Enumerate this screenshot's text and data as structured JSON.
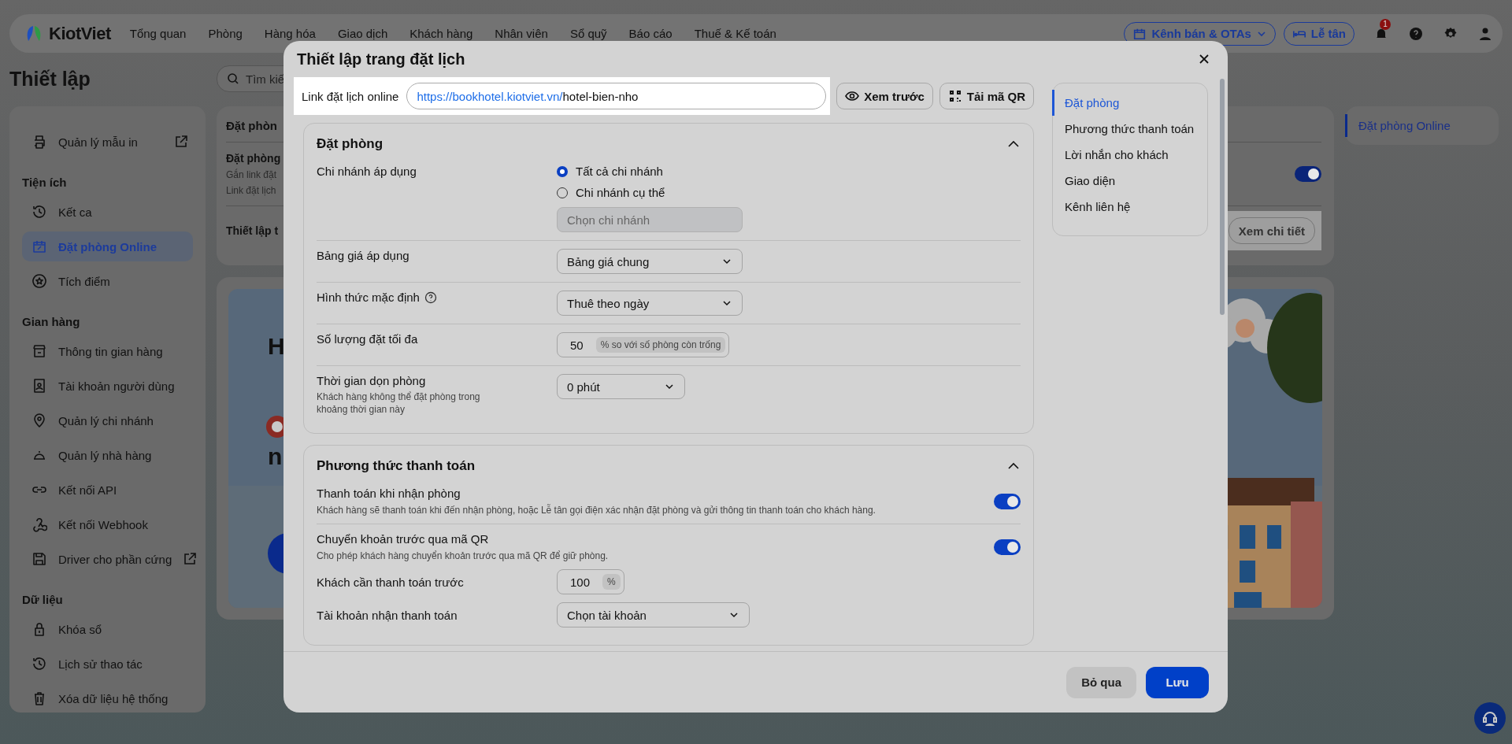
{
  "top_nav": {
    "logo": "KiotViet",
    "items": [
      "Tổng quan",
      "Phòng",
      "Hàng hóa",
      "Giao dịch",
      "Khách hàng",
      "Nhân viên",
      "Sổ quỹ",
      "Báo cáo",
      "Thuế & Kế toán"
    ],
    "channel_button": "Kênh bán & OTAs",
    "reception_button": "Lễ tân",
    "notification_count": "1"
  },
  "page": {
    "title": "Thiết lập",
    "search_placeholder": "Tìm kiế"
  },
  "sidebar": {
    "sections": [
      {
        "items": [
          {
            "label": "Quản lý mẫu in",
            "external": true,
            "selected": false
          }
        ]
      },
      {
        "heading": "Tiện ích",
        "items": [
          {
            "label": "Kết ca",
            "external": false,
            "selected": false
          },
          {
            "label": "Đặt phòng Online",
            "external": false,
            "selected": true
          },
          {
            "label": "Tích điểm",
            "external": false,
            "selected": false
          }
        ]
      },
      {
        "heading": "Gian hàng",
        "items": [
          {
            "label": "Thông tin gian hàng",
            "external": false,
            "selected": false
          },
          {
            "label": "Tài khoản người dùng",
            "external": false,
            "selected": false
          },
          {
            "label": "Quản lý chi nhánh",
            "external": false,
            "selected": false
          },
          {
            "label": "Quản lý nhà hàng",
            "external": false,
            "selected": false
          },
          {
            "label": "Kết nối API",
            "external": false,
            "selected": false
          },
          {
            "label": "Kết nối Webhook",
            "external": false,
            "selected": false
          },
          {
            "label": "Driver cho phần cứng",
            "external": true,
            "selected": false
          }
        ]
      },
      {
        "heading": "Dữ liệu",
        "items": [
          {
            "label": "Khóa sổ",
            "external": false,
            "selected": false
          },
          {
            "label": "Lịch sử thao tác",
            "external": false,
            "selected": false
          },
          {
            "label": "Xóa dữ liệu hệ thống",
            "external": false,
            "selected": false
          }
        ]
      }
    ]
  },
  "settings_card": {
    "title": "Đặt phòn",
    "feature_title": "Đặt phòng",
    "feature_lines": [
      "Gắn link đặt",
      "Link đặt lịch"
    ],
    "enabled": true,
    "setup_label": "Thiết lập t",
    "detail_button": "Xem chi tiết"
  },
  "banner": {
    "lines": [
      "H",
      "n"
    ]
  },
  "right_nav": {
    "items": [
      {
        "label": "Đặt phòng Online",
        "selected": true
      }
    ]
  },
  "modal": {
    "title": "Thiết lập trang đặt lịch",
    "link": {
      "label": "Link đặt lịch online",
      "base_url": "https://bookhotel.kiotviet.vn/",
      "slug": "hotel-bien-nho"
    },
    "preview_button": "Xem trước",
    "qr_button": "Tải mã QR",
    "sections": [
      {
        "title": "Đặt phòng",
        "expanded": true,
        "rows": [
          {
            "kind": "radio",
            "label": "Chi nhánh áp dụng",
            "options": [
              {
                "label": "Tất cả chi nhánh",
                "selected": true
              },
              {
                "label": "Chi nhánh cụ thể",
                "selected": false
              }
            ],
            "select": {
              "placeholder": "Chọn chi nhánh",
              "disabled": true
            }
          },
          {
            "kind": "select",
            "label": "Bảng giá áp dụng",
            "help": false,
            "value": "Bảng giá chung"
          },
          {
            "kind": "select",
            "label": "Hình thức mặc định",
            "help": true,
            "value": "Thuê theo ngày"
          },
          {
            "kind": "number",
            "label": "Số lượng đặt tối đa",
            "value": "50",
            "unit": "% so với số phòng còn trống"
          },
          {
            "kind": "duration",
            "label": "Thời gian dọn phòng",
            "hint": "Khách hàng không thể đặt phòng trong khoảng thời gian này",
            "value": "0 phút"
          }
        ]
      },
      {
        "title": "Phương thức thanh toán",
        "expanded": true,
        "rows": [
          {
            "kind": "toggle",
            "label": "Thanh toán khi nhận phòng",
            "description": "Khách hàng sẽ thanh toán khi đến nhận phòng, hoặc Lễ tân gọi điện xác nhận đặt phòng và gửi thông tin thanh toán cho khách hàng.",
            "on": true
          },
          {
            "kind": "toggle",
            "label": "Chuyển khoản trước qua mã QR",
            "description": "Cho phép khách hàng chuyển khoản trước qua mã QR để giữ phòng.",
            "on": true,
            "children": [
              {
                "kind": "number",
                "label": "Khách cần thanh toán trước",
                "value": "100",
                "unit": "%"
              },
              {
                "kind": "select",
                "label": "Tài khoản nhận thanh toán",
                "help": false,
                "value": "Chọn tài khoản"
              }
            ]
          }
        ]
      }
    ],
    "nav": [
      {
        "label": "Đặt phòng",
        "selected": true
      },
      {
        "label": "Phương thức thanh toán",
        "selected": false
      },
      {
        "label": "Lời nhắn cho khách",
        "selected": false
      },
      {
        "label": "Giao diện",
        "selected": false
      },
      {
        "label": "Kênh liên hệ",
        "selected": false
      }
    ],
    "cancel_button": "Bỏ qua",
    "save_button": "Lưu"
  }
}
